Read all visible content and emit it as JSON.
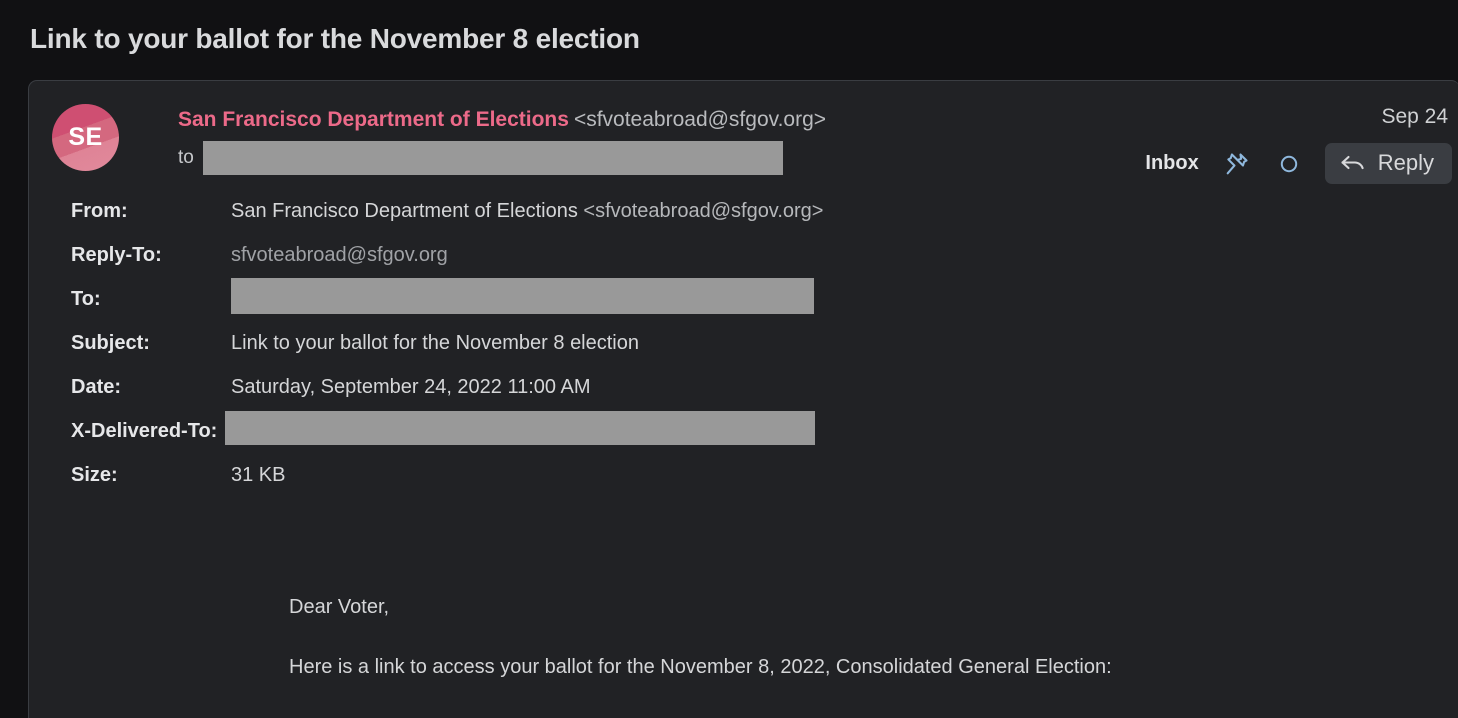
{
  "page_title": "Link to your ballot for the November 8 election",
  "summary": {
    "avatar_initials": "SE",
    "avatar_color": "#d4687f",
    "sender_name": "San Francisco Department of Elections",
    "sender_email": "<sfvoteabroad@sfgov.org>",
    "to_label": "to",
    "to_value_redacted": "",
    "date": "Sep 24",
    "folder_label": "Inbox",
    "pin_icon": "pin-icon",
    "unread_icon": "circle-unread-icon",
    "reply_icon": "reply-arrow-icon",
    "reply_label": "Reply",
    "accent_color": "#ec6a89",
    "icon_color": "#8fb8dd"
  },
  "headers": [
    {
      "label": "From:",
      "value": "San Francisco Department of Elections",
      "email": "<sfvoteabroad@sfgov.org>",
      "style": "normal",
      "redacted": false
    },
    {
      "label": "Reply-To:",
      "value": "sfvoteabroad@sfgov.org",
      "email": "",
      "style": "dim",
      "redacted": false
    },
    {
      "label": "To:",
      "value": "",
      "email": "",
      "style": "normal",
      "redacted": true
    },
    {
      "label": "Subject:",
      "value": "Link to your ballot for the November 8 election",
      "email": "",
      "style": "normal",
      "redacted": false
    },
    {
      "label": "Date:",
      "value": "Saturday, September 24, 2022 11:00 AM",
      "email": "",
      "style": "normal",
      "redacted": false
    },
    {
      "label": "X-Delivered-To:",
      "value": "",
      "email": "",
      "style": "normal",
      "redacted": true
    },
    {
      "label": "Size:",
      "value": "31 KB",
      "email": "",
      "style": "normal",
      "redacted": false
    }
  ],
  "body": {
    "greeting": "Dear Voter,",
    "paragraph_1": "Here is a link to access your ballot for the November 8, 2022, Consolidated General Election:"
  }
}
